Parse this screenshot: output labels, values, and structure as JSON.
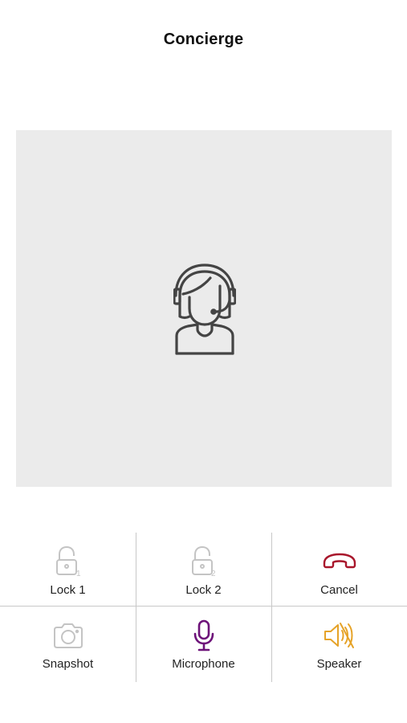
{
  "header": {
    "title": "Concierge"
  },
  "colors": {
    "video_bg": "#ebebeb",
    "divider": "#c8c8c8",
    "disabled_icon": "#c4c4c4",
    "cancel": "#a8162b",
    "microphone": "#6d1279",
    "speaker": "#e6a328",
    "avatar_stroke": "#444444"
  },
  "avatar": {
    "icon": "concierge-headset-icon"
  },
  "controls": [
    {
      "label": "Lock 1",
      "icon": "unlock-1-icon",
      "enabled": false
    },
    {
      "label": "Lock 2",
      "icon": "unlock-2-icon",
      "enabled": false
    },
    {
      "label": "Cancel",
      "icon": "hang-up-icon",
      "enabled": true
    },
    {
      "label": "Snapshot",
      "icon": "camera-icon",
      "enabled": false
    },
    {
      "label": "Microphone",
      "icon": "microphone-icon",
      "enabled": true
    },
    {
      "label": "Speaker",
      "icon": "speaker-muted-icon",
      "enabled": true
    }
  ]
}
